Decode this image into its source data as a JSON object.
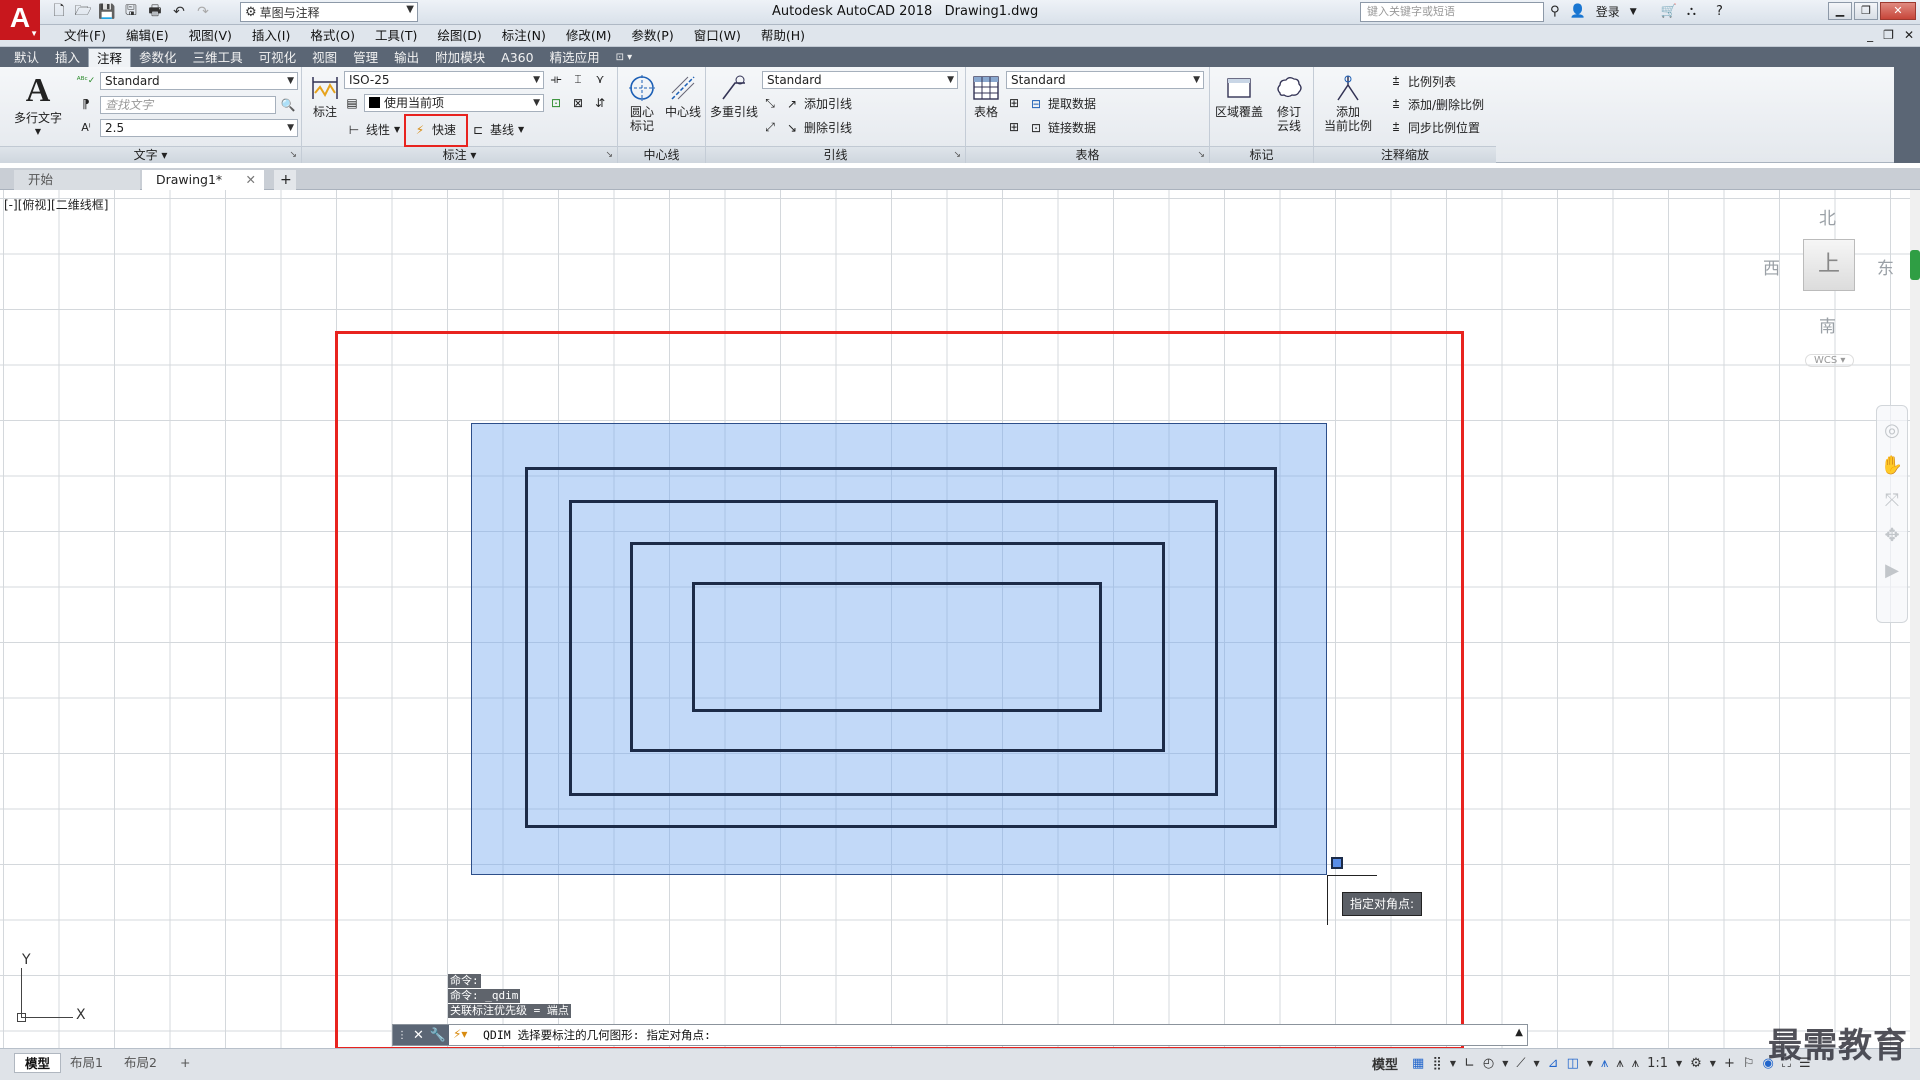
{
  "title_bar": {
    "app_letter": "A",
    "workspace": "草图与注释",
    "title": "Autodesk AutoCAD 2018",
    "filename": "Drawing1.dwg",
    "search_placeholder": "键入关键字或短语",
    "login": "登录"
  },
  "menu": {
    "items": [
      "文件(F)",
      "编辑(E)",
      "视图(V)",
      "插入(I)",
      "格式(O)",
      "工具(T)",
      "绘图(D)",
      "标注(N)",
      "修改(M)",
      "参数(P)",
      "窗口(W)",
      "帮助(H)"
    ]
  },
  "ribbon_tabs": {
    "items": [
      "默认",
      "插入",
      "注释",
      "参数化",
      "三维工具",
      "可视化",
      "视图",
      "管理",
      "输出",
      "附加模块",
      "A360",
      "精选应用"
    ],
    "active_index": 2
  },
  "ribbon": {
    "text_panel": {
      "title": "文字",
      "mtext_label": "多行文字",
      "style_value": "Standard",
      "find_placeholder": "查找文字",
      "height_value": "2.5"
    },
    "dim_panel": {
      "title": "标注",
      "dim_label": "标注",
      "dim_style": "ISO-25",
      "layer_value": "使用当前项",
      "linear": "线性",
      "quick": "快速",
      "baseline": "基线"
    },
    "centerline_panel": {
      "title": "中心线",
      "center_mark_line1": "圆心",
      "center_mark_line2": "标记",
      "centerline": "中心线"
    },
    "leader_panel": {
      "title": "引线",
      "mleader_label": "多重引线",
      "style_value": "Standard",
      "add_leader": "添加引线",
      "remove_leader": "删除引线"
    },
    "table_panel": {
      "title": "表格",
      "table_label": "表格",
      "style_value": "Standard",
      "extract_data": "提取数据",
      "link_data": "链接数据"
    },
    "markup_panel": {
      "title": "标记",
      "wipeout": "区域覆盖",
      "revcloud_line1": "修订",
      "revcloud_line2": "云线"
    },
    "scale_panel": {
      "title": "注释缩放",
      "add_line1": "添加",
      "add_line2": "当前比例",
      "scale_list": "比例列表",
      "add_delete_scale": "添加/删除比例",
      "sync_scale": "同步比例位置"
    }
  },
  "file_tabs": {
    "start": "开始",
    "drawing": "Drawing1*",
    "plus": "+"
  },
  "canvas": {
    "viewport_label": "[-][俯视][二维线框]",
    "viewcube": {
      "north": "北",
      "south": "南",
      "east": "东",
      "west": "西",
      "face": "上",
      "wcs": "WCS"
    },
    "tooltip": "指定对角点:",
    "ucs_x": "X",
    "ucs_y": "Y"
  },
  "command": {
    "history": [
      "命令:",
      "命令: _qdim",
      "关联标注优先级 = 端点"
    ],
    "current": "QDIM 选择要标注的几何图形: 指定对角点:"
  },
  "status_bar": {
    "tabs": [
      "模型",
      "布局1",
      "布局2"
    ],
    "plus": "+",
    "model_label": "模型",
    "scale": "1:1"
  },
  "watermark": "最需教育",
  "colors": {
    "highlight_red": "#e8231f",
    "selection_fill": "#78aaf0",
    "ribbon_tab_bar": "#5b6675",
    "logo_red": "#c8171d"
  }
}
